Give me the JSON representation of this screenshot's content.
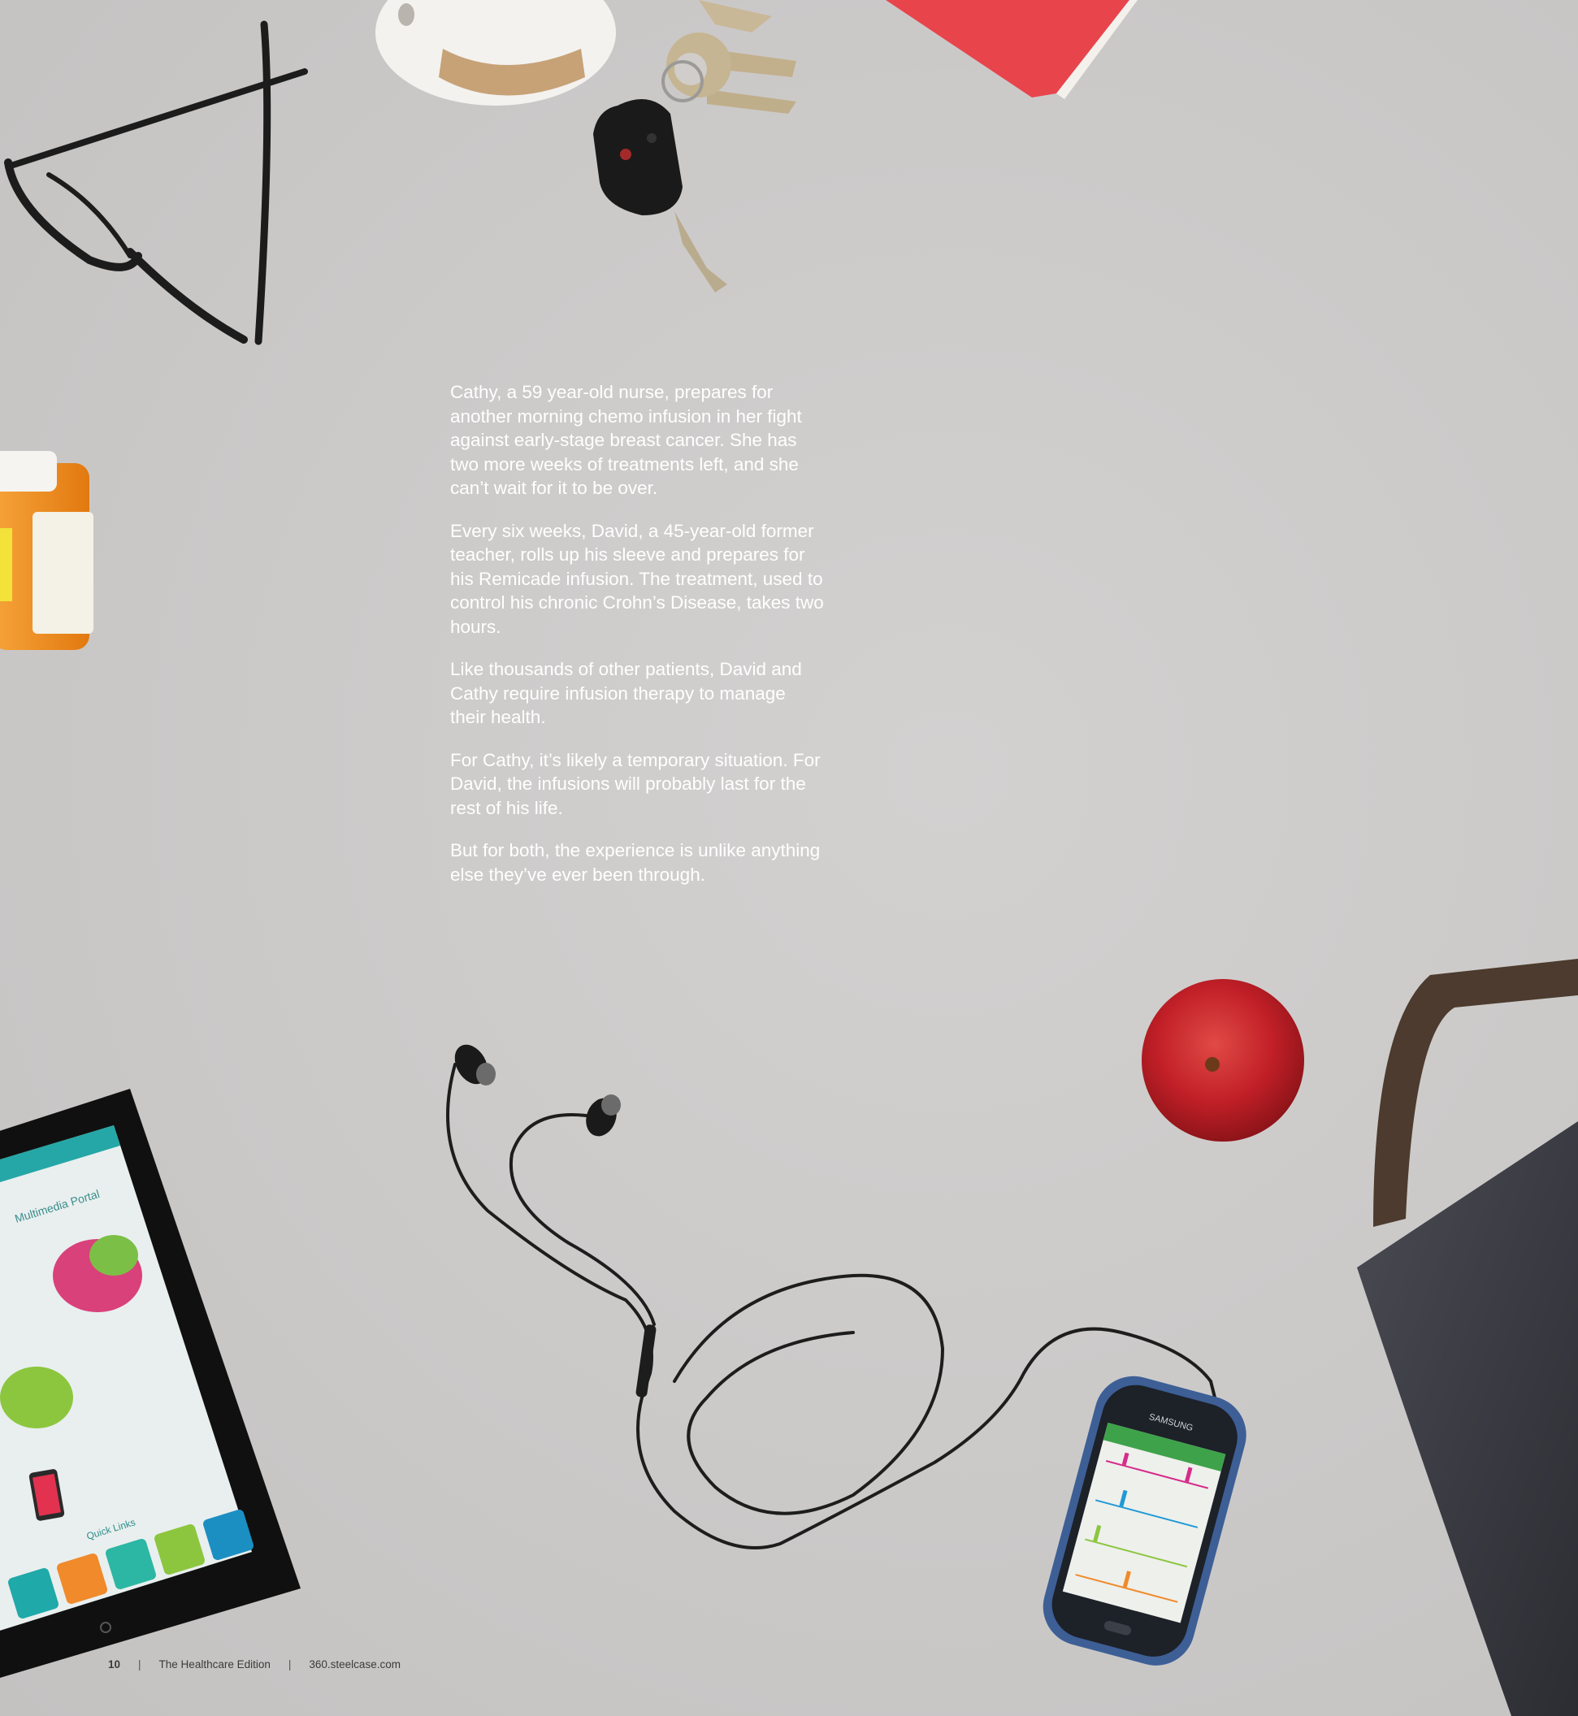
{
  "article": {
    "paragraphs": [
      "Cathy, a 59 year-old nurse, prepares for another morning chemo infusion in her fight against early-stage breast cancer. She has two more weeks of treatments left, and she can’t wait for it to be over.",
      "Every six weeks, David, a 45-year-old former teacher, rolls up his sleeve and prepares for his Remicade infusion. The treatment, used to control his chronic Crohn’s Disease, takes two hours.",
      "Like thousands of other patients, David and Cathy require infusion therapy to manage their health.",
      "For Cathy, it’s likely a temporary situation. For David, the infusions will probably last for the rest of his life.",
      "But for both, the experience is unlike anything else they’ve ever been through."
    ]
  },
  "footer": {
    "page_number": "10",
    "separator": "|",
    "edition": "The Healthcare Edition",
    "website": "360.steelcase.com"
  },
  "photo": {
    "tablet": {
      "screen_title": "Multimedia Portal",
      "quick_links_label": "Quick Links",
      "quick_link_colors": [
        "#1fa9a9",
        "#f08a2a",
        "#2cb7a4",
        "#8cc63f",
        "#1c8fc2"
      ]
    },
    "phone": {
      "brand": "SAMSUNG"
    },
    "colors": {
      "apple": "#c8202a",
      "book": "#e8444c",
      "pill_bottle": "#f08a1e",
      "bag": "#3c3d45"
    }
  }
}
